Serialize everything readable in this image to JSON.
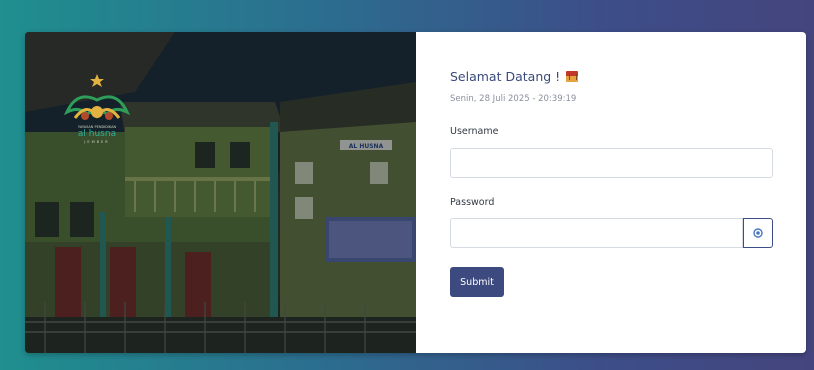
{
  "login": {
    "greeting": "Selamat Datang !",
    "greeting_icon": "gift-icon",
    "datetime": "Senin, 28 Juli 2025 - 20:39:19",
    "username_label": "Username",
    "username_value": "",
    "password_label": "Password",
    "password_value": "",
    "password_toggle_icon": "eye-icon",
    "submit_label": "Submit"
  },
  "branding": {
    "logo_icon": "school-logo-icon",
    "logo_text": "al husna",
    "logo_subtext": "YAYASAN PENDIDIKAN",
    "logo_city": "JEMBER",
    "building_sign": "AL HUSNA"
  },
  "colors": {
    "primary": "#3d4a80",
    "background_start": "#1f8f8f",
    "background_end": "#45457e",
    "greeting_text": "#3a4a7a"
  }
}
